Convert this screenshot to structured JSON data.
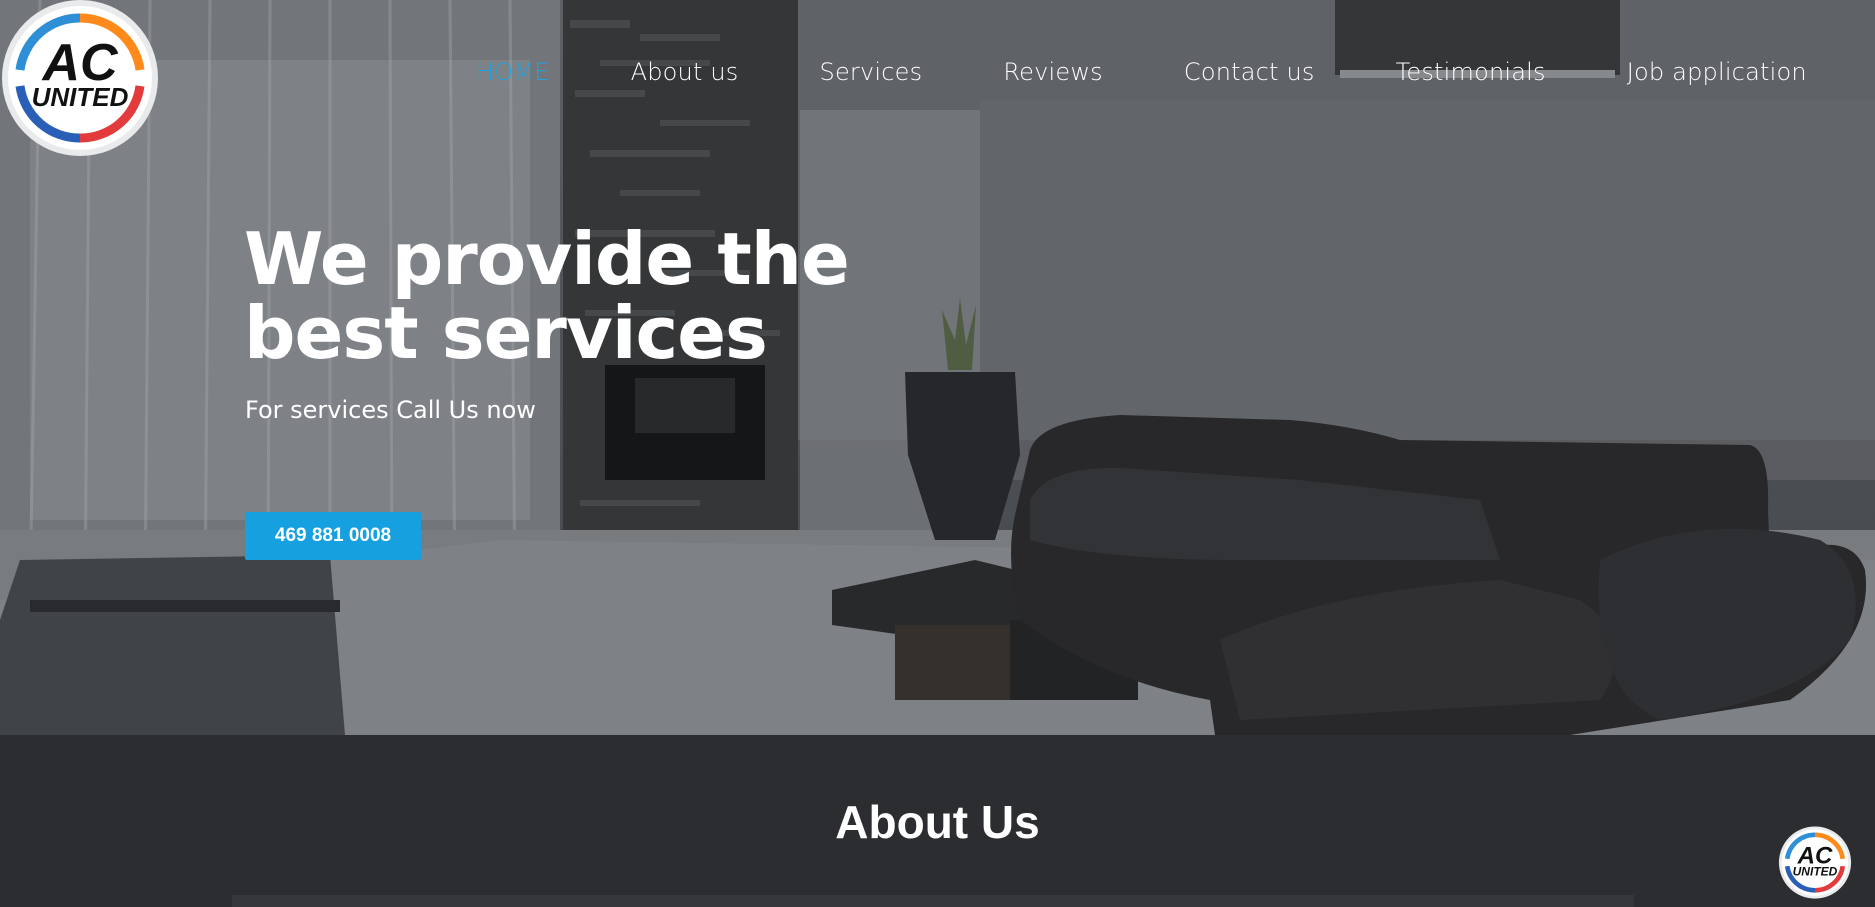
{
  "brand": {
    "logo_line1": "AC",
    "logo_line2": "UNITED"
  },
  "nav": {
    "items": [
      {
        "label": "HOME",
        "active": true
      },
      {
        "label": "About us",
        "active": false
      },
      {
        "label": "Services",
        "active": false
      },
      {
        "label": "Reviews",
        "active": false
      },
      {
        "label": "Contact us",
        "active": false
      },
      {
        "label": "Testimonials",
        "active": false
      },
      {
        "label": "Job application",
        "active": false
      }
    ]
  },
  "hero": {
    "title_line1": "We provide the",
    "title_line2": "best services",
    "subtitle": "For services Call Us now",
    "cta_label": "469 881 0008"
  },
  "about": {
    "title": "About Us"
  },
  "colors": {
    "accent": "#1ea4e0",
    "button": "#17a0e0",
    "section_bg": "#2b2d30"
  }
}
